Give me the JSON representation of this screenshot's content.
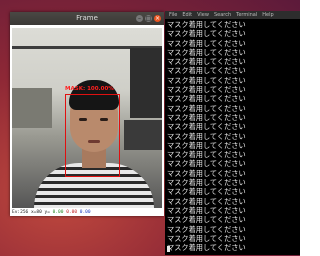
{
  "frame_window": {
    "title": "Frame",
    "detection_label": "MASK: 100.00%",
    "status": {
      "prefix": "Ev:256 x=80 y= ",
      "green": "0.00",
      "mid": " ",
      "red": "0.00",
      "mid2": " ",
      "blue": "0.00"
    }
  },
  "terminal": {
    "menu": [
      "File",
      "Edit",
      "View",
      "Search",
      "Terminal",
      "Help"
    ],
    "lines": [
      "マスク着用してください",
      "マスク着用してください",
      "マスク着用してください",
      "マスク着用してください",
      "マスク着用してください",
      "マスク着用してください",
      "マスク着用してください",
      "マスク着用してください",
      "マスク着用してください",
      "マスク着用してください",
      "マスク着用してください",
      "マスク着用してください",
      "マスク着用してください",
      "マスク着用してください",
      "マスク着用してください",
      "マスク着用してください",
      "マスク着用してください",
      "マスク着用してください",
      "マスク着用してください",
      "マスク着用してください",
      "マスク着用してください",
      "マスク着用してください",
      "マスク着用してください",
      "マスク着用してください",
      "マスク着用してください"
    ]
  },
  "colors": {
    "desktop": "#8e2836",
    "detection_box": "#e01010",
    "terminal_bg": "#000000",
    "terminal_text": "#e6e6e6"
  }
}
